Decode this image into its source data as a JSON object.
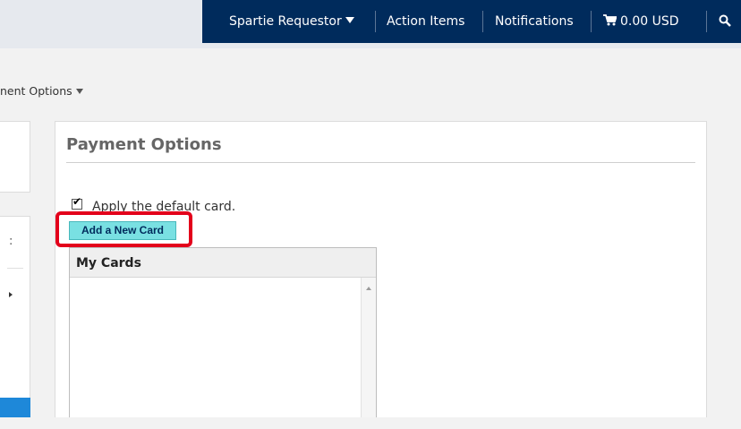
{
  "topnav": {
    "user_menu": "Spartie Requestor",
    "action_items": "Action Items",
    "notifications": "Notifications",
    "cart_amount": "0.00 USD",
    "icons": {
      "user_menu": "caret-down-icon",
      "cart": "cart-icon",
      "search": "search-icon"
    }
  },
  "breadcrumb": {
    "label": "nent Options"
  },
  "payment": {
    "title": "Payment Options",
    "default_card_label": "Apply the default card.",
    "default_card_checked": true,
    "add_card_label": "Add a New Card",
    "my_cards_header": "My Cards"
  },
  "colors": {
    "nav_bg": "#002b5c",
    "add_card_bg": "#79e0e2",
    "highlight": "#e3001b",
    "accent_blue": "#1e88d9"
  }
}
